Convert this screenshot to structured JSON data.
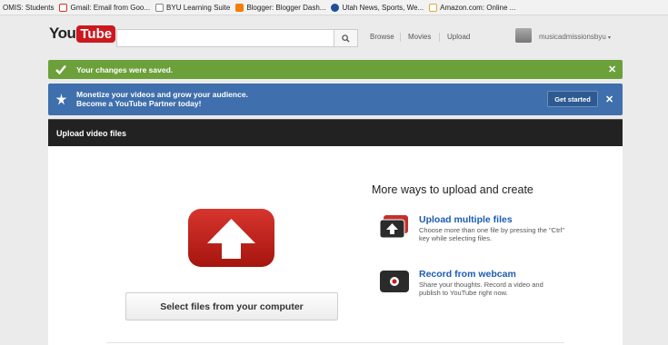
{
  "bookmarks": [
    {
      "label": "OMIS: Students",
      "icon": "omis-icon",
      "color": "#f2f2f2"
    },
    {
      "label": "Gmail: Email from Goo...",
      "icon": "gmail-icon",
      "color": "#d93025"
    },
    {
      "label": "BYU Learning Suite",
      "icon": "byu-icon",
      "color": "#6a6a6a"
    },
    {
      "label": "Blogger: Blogger Dash...",
      "icon": "blogger-icon",
      "color": "#f57d00"
    },
    {
      "label": "Utah News, Sports, We...",
      "icon": "ksl-icon",
      "color": "#1f4f99"
    },
    {
      "label": "Amazon.com: Online ...",
      "icon": "amazon-icon",
      "color": "#e8a33b"
    }
  ],
  "header": {
    "logo_you": "You",
    "logo_tube": "Tube",
    "search_placeholder": "",
    "search_icon": "search-icon",
    "nav": {
      "browse": "Browse",
      "movies": "Movies",
      "upload": "Upload"
    },
    "username": "musicadmissionsbyu"
  },
  "alerts": {
    "saved": {
      "text": "Your changes were saved.",
      "icon": "check-icon",
      "color": "#6ba03a"
    },
    "partner": {
      "line1": "Monetize your videos and grow your audience.",
      "line2": "Become a YouTube Partner today!",
      "button": "Get started",
      "icon": "star-icon",
      "color": "#3f6fac"
    }
  },
  "upload": {
    "title": "Upload video files",
    "select_button": "Select files from your computer",
    "more_title": "More ways to upload and create",
    "ways": [
      {
        "title": "Upload multiple files",
        "desc": "Choose more than one file by pressing the \"Ctrl\" key while selecting files.",
        "icon": "upload-multiple-icon"
      },
      {
        "title": "Record from webcam",
        "desc": "Share your thoughts. Record a video and publish to YouTube right now.",
        "icon": "webcam-icon"
      }
    ]
  },
  "colors": {
    "accent_red": "#cc181e",
    "link_blue": "#1c5bb0"
  }
}
